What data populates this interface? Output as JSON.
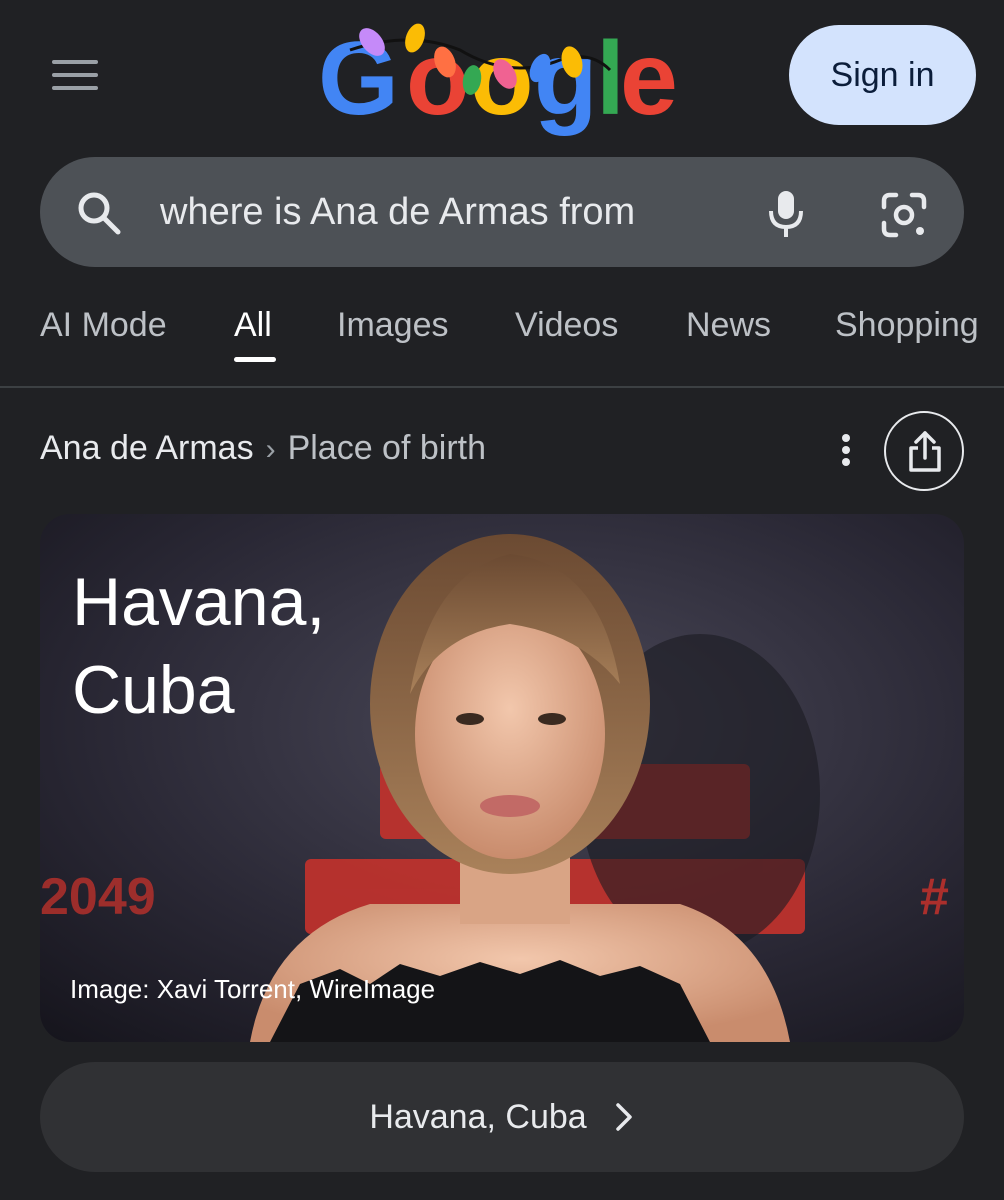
{
  "header": {
    "logo_text": "Google",
    "signin_label": "Sign in"
  },
  "search": {
    "query": "where is Ana de Armas from"
  },
  "tabs": [
    {
      "label": "AI Mode",
      "active": false
    },
    {
      "label": "All",
      "active": true
    },
    {
      "label": "Images",
      "active": false
    },
    {
      "label": "Videos",
      "active": false
    },
    {
      "label": "News",
      "active": false
    },
    {
      "label": "Shopping",
      "active": false
    }
  ],
  "breadcrumb": {
    "entity": "Ana de Armas",
    "separator": "›",
    "attribute": "Place of birth"
  },
  "card": {
    "title": "Havana, Cuba",
    "credit": "Image: Xavi Torrent, WireImage",
    "backdrop_text_left": "2049",
    "backdrop_text_right": "#"
  },
  "answer": {
    "label": "Havana, Cuba"
  },
  "icons": {
    "menu": "hamburger-menu-icon",
    "search": "search-icon",
    "mic": "microphone-icon",
    "lens": "google-lens-icon",
    "more": "more-vert-icon",
    "share": "share-icon",
    "chevron": "chevron-right-icon"
  },
  "colors": {
    "background": "#202124",
    "searchbar": "#4d5156",
    "signin_bg": "#d3e3fd",
    "chip_bg": "#303134"
  }
}
